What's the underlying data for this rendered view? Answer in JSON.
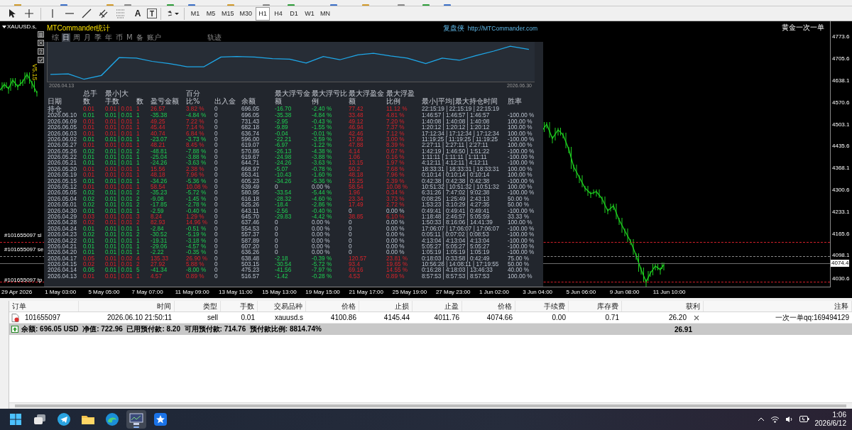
{
  "toolbar": {
    "tools": [
      {
        "kind": "cursor"
      },
      {
        "kind": "crosshair"
      },
      {
        "kind": "vline"
      },
      {
        "kind": "hline"
      },
      {
        "kind": "trend"
      },
      {
        "kind": "channel"
      },
      {
        "kind": "fibo"
      },
      {
        "kind": "text",
        "glyph": "A"
      },
      {
        "kind": "label",
        "glyph": "T"
      },
      {
        "kind": "shapes"
      }
    ],
    "timeframes": [
      {
        "label": "M1",
        "selected": false
      },
      {
        "label": "M5",
        "selected": false
      },
      {
        "label": "M15",
        "selected": false
      },
      {
        "label": "M30",
        "selected": false
      },
      {
        "label": "H1",
        "selected": true
      },
      {
        "label": "H4",
        "selected": false
      },
      {
        "label": "D1",
        "selected": false
      },
      {
        "label": "W1",
        "selected": false
      },
      {
        "label": "MN",
        "selected": false
      }
    ]
  },
  "chart": {
    "symbol": "XAUUSD.s,",
    "version": "V5.15",
    "ea_name": "黄金一次一单",
    "order_lines": [
      {
        "label": "#101655097 sl",
        "kind": "sl"
      },
      {
        "label": "#101655097 se",
        "kind": "entry"
      },
      {
        "label": "#101655097 tp",
        "kind": "tp"
      }
    ],
    "price_labels": [
      "4773.6",
      "4705.6",
      "4638.1",
      "4570.6",
      "4503.1",
      "4435.6",
      "4368.1",
      "4300.6",
      "4233.1",
      "4165.6",
      "4098.1"
    ],
    "current_price": "4074.4",
    "low_label": "4030.6",
    "time_labels": [
      "29 Apr 2026",
      "1 May 03:00",
      "5 May 05:00",
      "7 May 07:00",
      "11 May 09:00",
      "13 May 11:00",
      "15 May 13:00",
      "19 May 15:00",
      "21 May 17:00",
      "25 May 19:00",
      "27 May 23:00",
      "1 Jun 02:00",
      "3 Jun 04:00",
      "5 Jun 06:00",
      "9 Jun 08:00",
      "11 Jun 10:00"
    ]
  },
  "stats_panel": {
    "title": "MTCommander统计",
    "brand": "复盘侠",
    "url": "http://MTCommander.com",
    "tabs": [
      {
        "label": "综",
        "kind": "period",
        "selected": false
      },
      {
        "label": "日",
        "kind": "period",
        "selected": true
      },
      {
        "label": "周",
        "kind": "period",
        "selected": false
      },
      {
        "label": "月",
        "kind": "period",
        "selected": false
      },
      {
        "label": "季",
        "kind": "period",
        "selected": false
      },
      {
        "label": "年",
        "kind": "period",
        "selected": false
      },
      {
        "label": "币",
        "kind": "period",
        "selected": false
      },
      {
        "label": "M",
        "kind": "period",
        "selected": false
      },
      {
        "label": "备",
        "kind": "period",
        "selected": false
      },
      {
        "label": "账户",
        "kind": "period",
        "selected": false
      },
      {
        "label": "轨迹",
        "kind": "view",
        "selected": false
      }
    ],
    "equity_start": "2026.04.13",
    "equity_end": "2026.06.30",
    "columns": [
      "日期",
      "总手数",
      "最小|大手数",
      "数",
      "盈亏金额",
      "百分比%",
      "出入金",
      "余额",
      "最大浮亏金额",
      "最大浮亏比例",
      "最大浮盈金额",
      "最大浮盈比例",
      "最小|平均|最大持仓时间",
      "胜率"
    ],
    "rows": [
      {
        "kind": "open",
        "drawdown": true,
        "runup": true,
        "cells": [
          "持仓",
          "0.01",
          "0.01 | 0.01",
          "1",
          "26.57",
          "3.82 %",
          "0",
          "696.05",
          "-16.70",
          "-2.40 %",
          "77.42",
          "11.12 %",
          "22:15:19 | 22:15:19 | 22:15:19"
        ]
      },
      {
        "kind": "loss",
        "drawdown": true,
        "runup": true,
        "cells": [
          "2026.06.10",
          "0.01",
          "0.01 | 0.01",
          "1",
          "-35.38",
          "-4.84 %",
          "0",
          "696.05",
          "-35.38",
          "-4.84 %",
          "33.48",
          "4.81 %",
          "1:46:57 | 1:46:57 | 1:46:57",
          "-100.00 %"
        ]
      },
      {
        "kind": "win",
        "drawdown": true,
        "runup": true,
        "cells": [
          "2026.06.09",
          "0.01",
          "0.01 | 0.01",
          "1",
          "49.25",
          "7.22 %",
          "0",
          "731.43",
          "-2.95",
          "-0.43 %",
          "49.12",
          "7.20 %",
          "1:40:08 | 1:40:08 | 1:40:08",
          "100.00 %"
        ]
      },
      {
        "kind": "win",
        "drawdown": true,
        "runup": true,
        "cells": [
          "2026.06.05",
          "0.01",
          "0.01 | 0.01",
          "1",
          "45.44",
          "7.14 %",
          "0",
          "682.18",
          "-9.89",
          "-1.55 %",
          "46.94",
          "7.37 %",
          "1:20:12 | 1:20:12 | 1:20:12",
          "100.00 %"
        ]
      },
      {
        "kind": "win",
        "drawdown": true,
        "runup": true,
        "cells": [
          "2026.06.03",
          "0.01",
          "0.01 | 0.01",
          "1",
          "40.74",
          "6.84 %",
          "0",
          "636.74",
          "-0.04",
          "-0.01 %",
          "42.46",
          "7.12 %",
          "17:12:34 | 17:12:34 | 17:12:34",
          "100.00 %"
        ]
      },
      {
        "kind": "loss",
        "drawdown": true,
        "runup": true,
        "cells": [
          "2026.06.02",
          "0.01",
          "0.01 | 0.01",
          "1",
          "-23.07",
          "-3.73 %",
          "0",
          "596.00",
          "-22.21",
          "-3.59 %",
          "17.86",
          "3.00 %",
          "11:19:25 | 11:19:25 | 11:19:25",
          "-100.00 %"
        ]
      },
      {
        "kind": "win",
        "drawdown": true,
        "runup": true,
        "cells": [
          "2026.05.27",
          "0.01",
          "0.01 | 0.01",
          "1",
          "48.21",
          "8.45 %",
          "0",
          "619.07",
          "-6.97",
          "-1.22 %",
          "47.88",
          "8.39 %",
          "2:27:11 | 2:27:11 | 2:27:11",
          "100.00 %"
        ]
      },
      {
        "kind": "loss",
        "drawdown": true,
        "runup": true,
        "cells": [
          "2026.05.26",
          "0.02",
          "0.01 | 0.01",
          "2",
          "-48.81",
          "-7.88 %",
          "0",
          "570.86",
          "-26.13",
          "-4.38 %",
          "4.14",
          "0.67 %",
          "1:42:19 | 1:46:50 | 1:51:22",
          "-100.00 %"
        ]
      },
      {
        "kind": "loss",
        "drawdown": true,
        "runup": true,
        "cells": [
          "2026.05.22",
          "0.01",
          "0.01 | 0.01",
          "1",
          "-25.04",
          "-3.88 %",
          "0",
          "619.67",
          "-24.98",
          "-3.88 %",
          "1.06",
          "0.16 %",
          "1:11:11 | 1:11:11 | 1:11:11",
          "-100.00 %"
        ]
      },
      {
        "kind": "loss",
        "drawdown": true,
        "runup": true,
        "cells": [
          "2026.05.21",
          "0.01",
          "0.01 | 0.01",
          "1",
          "-24.26",
          "-3.63 %",
          "0",
          "644.71",
          "-24.26",
          "-3.63 %",
          "13.15",
          "1.97 %",
          "4:12:11 | 4:12:11 | 4:12:11",
          "-100.00 %"
        ]
      },
      {
        "kind": "win",
        "drawdown": true,
        "runup": true,
        "cells": [
          "2026.05.20",
          "0.01",
          "0.01 | 0.01",
          "1",
          "15.56",
          "2.38 %",
          "0",
          "668.97",
          "-5.07",
          "-0.78 %",
          "50.2",
          "7.68 %",
          "18:33:31 | 18:33:31 | 18:33:31",
          "100.00 %"
        ]
      },
      {
        "kind": "win",
        "drawdown": true,
        "runup": true,
        "cells": [
          "2026.05.19",
          "0.01",
          "0.01 | 0.01",
          "1",
          "48.18",
          "7.96 %",
          "0",
          "653.41",
          "-10.43",
          "-1.60 %",
          "48.18",
          "7.96 %",
          "0:10:14 | 0:10:14 | 0:10:14",
          "100.00 %"
        ]
      },
      {
        "kind": "loss",
        "drawdown": true,
        "runup": true,
        "cells": [
          "2026.05.15",
          "0.01",
          "0.01 | 0.01",
          "1",
          "-34.26",
          "-5.36 %",
          "0",
          "605.23",
          "-34.26",
          "-5.36 %",
          "15.25",
          "2.39 %",
          "0:42:38 | 0:42:38 | 0:42:38",
          "-100.00 %"
        ]
      },
      {
        "kind": "win",
        "drawdown": false,
        "runup": true,
        "cells": [
          "2026.05.12",
          "0.01",
          "0.01 | 0.01",
          "1",
          "58.54",
          "10.08 %",
          "0",
          "639.49",
          "0",
          "0.00 %",
          "58.54",
          "10.08 %",
          "10:51:32 | 10:51:32 | 10:51:32",
          "100.00 %"
        ]
      },
      {
        "kind": "loss",
        "drawdown": true,
        "runup": true,
        "cells": [
          "2026.05.05",
          "0.02",
          "0.01 | 0.01",
          "2",
          "-35.23",
          "-5.72 %",
          "0",
          "580.95",
          "-33.54",
          "-5.44 %",
          "1.96",
          "0.34 %",
          "6:31:26 | 7:47:02 | 9:02:38",
          "-100.00 %"
        ]
      },
      {
        "kind": "loss",
        "drawdown": true,
        "runup": true,
        "cells": [
          "2026.05.04",
          "0.02",
          "0.01 | 0.01",
          "2",
          "-9.08",
          "-1.45 %",
          "0",
          "616.18",
          "-28.32",
          "-4.60 %",
          "23.34",
          "3.73 %",
          "0:08:25 | 1:25:49 | 2:43:13",
          "50.00 %"
        ]
      },
      {
        "kind": "loss",
        "drawdown": true,
        "runup": true,
        "cells": [
          "2026.05.01",
          "0.02",
          "0.01 | 0.01",
          "2",
          "-17.85",
          "-2.78 %",
          "0",
          "625.26",
          "-18.4",
          "-2.86 %",
          "17.49",
          "2.72 %",
          "1:53:23 | 3:10:29 | 4:27:35",
          "50.00 %"
        ]
      },
      {
        "kind": "loss",
        "drawdown": true,
        "runup": false,
        "cells": [
          "2026.04.30",
          "0.01",
          "0.01 | 0.01",
          "1",
          "-2.59",
          "-0.40 %",
          "0",
          "643.11",
          "-2.56",
          "-0.40 %",
          "0",
          "0.00 %",
          "0:49:41 | 0:49:41 | 0:49:41",
          "-100.00 %"
        ]
      },
      {
        "kind": "win",
        "drawdown": true,
        "runup": true,
        "cells": [
          "2026.04.29",
          "0.03",
          "0.01 | 0.01",
          "3",
          "8.24",
          "1.29 %",
          "0",
          "645.70",
          "-29.83",
          "-4.42 %",
          "38.85",
          "6.10 %",
          "1:18:48 | 2:46:57 | 5:05:59",
          "33.33 %"
        ]
      },
      {
        "kind": "win",
        "drawdown": false,
        "runup": false,
        "cells": [
          "2026.04.28",
          "0.02",
          "0.01 | 0.01",
          "2",
          "82.93",
          "14.96 %",
          "0",
          "637.46",
          "0",
          "0.00 %",
          "0",
          "0.00 %",
          "1:50:33 | 8:16:06 | 14:41:39",
          "100.00 %"
        ]
      },
      {
        "kind": "loss",
        "drawdown": false,
        "runup": false,
        "cells": [
          "2026.04.24",
          "0.01",
          "0.01 | 0.01",
          "1",
          "-2.84",
          "-0.51 %",
          "0",
          "554.53",
          "0",
          "0.00 %",
          "0",
          "0.00 %",
          "17:06:07 | 17:06:07 | 17:06:07",
          "-100.00 %"
        ]
      },
      {
        "kind": "loss",
        "drawdown": false,
        "runup": false,
        "cells": [
          "2026.04.23",
          "0.02",
          "0.01 | 0.01",
          "2",
          "-30.52",
          "-5.19 %",
          "0",
          "557.37",
          "0",
          "0.00 %",
          "0",
          "0.00 %",
          "0:05:11 | 0:07:02 | 0:08:53",
          "-100.00 %"
        ]
      },
      {
        "kind": "loss",
        "drawdown": false,
        "runup": false,
        "cells": [
          "2026.04.22",
          "0.01",
          "0.01 | 0.01",
          "1",
          "-19.31",
          "-3.18 %",
          "0",
          "587.89",
          "0",
          "0.00 %",
          "0",
          "0.00 %",
          "4:13:04 | 4:13:04 | 4:13:04",
          "-100.00 %"
        ]
      },
      {
        "kind": "loss",
        "drawdown": false,
        "runup": false,
        "cells": [
          "2026.04.21",
          "0.01",
          "0.01 | 0.01",
          "1",
          "-29.06",
          "-4.57 %",
          "0",
          "607.20",
          "0",
          "0.00 %",
          "0",
          "0.00 %",
          "5:05:27 | 5:05:27 | 5:05:27",
          "-100.00 %"
        ]
      },
      {
        "kind": "loss",
        "drawdown": false,
        "runup": false,
        "cells": [
          "2026.04.20",
          "0.01",
          "0.01 | 0.01",
          "1",
          "-2.22",
          "-0.35 %",
          "0",
          "636.26",
          "0",
          "0.00 %",
          "0",
          "0.00 %",
          "1:05:19 | 1:05:19 | 1:05:19",
          "-100.00 %"
        ]
      },
      {
        "kind": "win",
        "drawdown": true,
        "runup": true,
        "cells": [
          "2026.04.17",
          "0.05",
          "0.01 | 0.02",
          "4",
          "135.33",
          "26.90 %",
          "0",
          "638.48",
          "-2.18",
          "-0.39 %",
          "120.57",
          "23.81 %",
          "0:18:03 | 0:33:58 | 0:42:49",
          "75.00 %"
        ]
      },
      {
        "kind": "win",
        "drawdown": true,
        "runup": true,
        "cells": [
          "2026.04.15",
          "0.02",
          "0.01 | 0.01",
          "2",
          "27.92",
          "5.88 %",
          "0",
          "503.15",
          "-30.54",
          "-5.72 %",
          "93.4",
          "19.65 %",
          "10:56:28 | 14:08:11 | 17:19:55",
          "50.00 %"
        ]
      },
      {
        "kind": "loss",
        "drawdown": true,
        "runup": true,
        "cells": [
          "2026.04.14",
          "0.05",
          "0.01 | 0.01",
          "5",
          "-41.34",
          "-8.00 %",
          "0",
          "475.23",
          "-41.56",
          "-7.97 %",
          "69.16",
          "14.55 %",
          "0:16:28 | 4:18:03 | 13:46:33",
          "40.00 %"
        ]
      },
      {
        "kind": "win",
        "drawdown": true,
        "runup": true,
        "cells": [
          "2026.04.13",
          "0.01",
          "0.01 | 0.01",
          "1",
          "4.57",
          "0.89 %",
          "0",
          "516.57",
          "-1.42",
          "-0.28 %",
          "4.53",
          "0.89 %",
          "8:57:53 | 8:57:53 | 8:57:53",
          "100.00 %"
        ]
      }
    ]
  },
  "terminal": {
    "columns": [
      "订单",
      "时间",
      "类型",
      "手数",
      "交易品种",
      "价格",
      "止损",
      "止盈",
      "价格",
      "手续费",
      "库存费",
      "获利",
      "注释"
    ],
    "orders": [
      {
        "cells": [
          "101655097",
          "2026.06.10 21:50:11",
          "sell",
          "0.01",
          "xauusd.s",
          "4100.86",
          "4145.44",
          "4011.76",
          "4074.66",
          "0.00",
          "0.71",
          "26.20",
          "一次一单qq:169494129"
        ]
      }
    ],
    "summary": {
      "text": "余额: 696.05 USD  净值: 722.96  已用预付款: 8.20  可用预付款: 714.76  预付款比例: 8814.74%",
      "profit": "26.91"
    }
  },
  "taskbar": {
    "apps": [
      {
        "kind": "start",
        "selected": false
      },
      {
        "kind": "taskview",
        "selected": false
      },
      {
        "kind": "telegram",
        "selected": false
      },
      {
        "kind": "folder",
        "selected": false
      },
      {
        "kind": "edge",
        "selected": false
      },
      {
        "kind": "terminal",
        "selected": true
      },
      {
        "kind": "star",
        "selected": false
      }
    ],
    "time": "1:06",
    "date": "2026/6/12"
  }
}
